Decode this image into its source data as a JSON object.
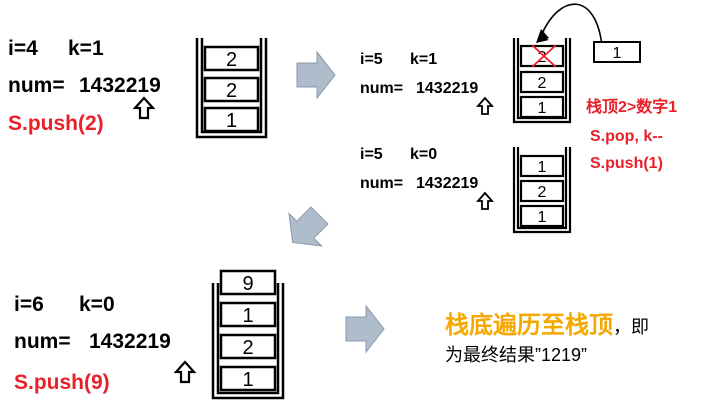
{
  "colors": {
    "black": "#000000",
    "red": "#e8202a",
    "orange": "#f5a800",
    "arrow_fill": "#aebccb",
    "arrow_stroke": "#8a9aab"
  },
  "panel1": {
    "i_label": "i=4",
    "k_label": "k=1",
    "num_label": "num=",
    "num_value": "1432219",
    "op": "S.push(2)",
    "stack": [
      "2",
      "2",
      "1"
    ]
  },
  "panel2": {
    "i_label": "i=5",
    "k_label": "k=1",
    "num_label": "num=",
    "num_value": "1432219",
    "stack": [
      "2",
      "2",
      "1"
    ],
    "popped": "1",
    "note_line1": "栈顶2>数字1",
    "note_line2": "S.pop, k--",
    "note_line3": "S.push(1)"
  },
  "panel3": {
    "i_label": "i=5",
    "k_label": "k=0",
    "num_label": "num=",
    "num_value": "1432219",
    "stack": [
      "1",
      "2",
      "1"
    ]
  },
  "panel4": {
    "i_label": "i=6",
    "k_label": "k=0",
    "num_label": "num=",
    "num_value": "1432219",
    "op": "S.push(9)",
    "stack": [
      "9",
      "1",
      "2",
      "1"
    ]
  },
  "result": {
    "highlight": "栈底遍历至栈顶",
    "suffix": "，即",
    "line2": "为最终结果”1219”"
  }
}
